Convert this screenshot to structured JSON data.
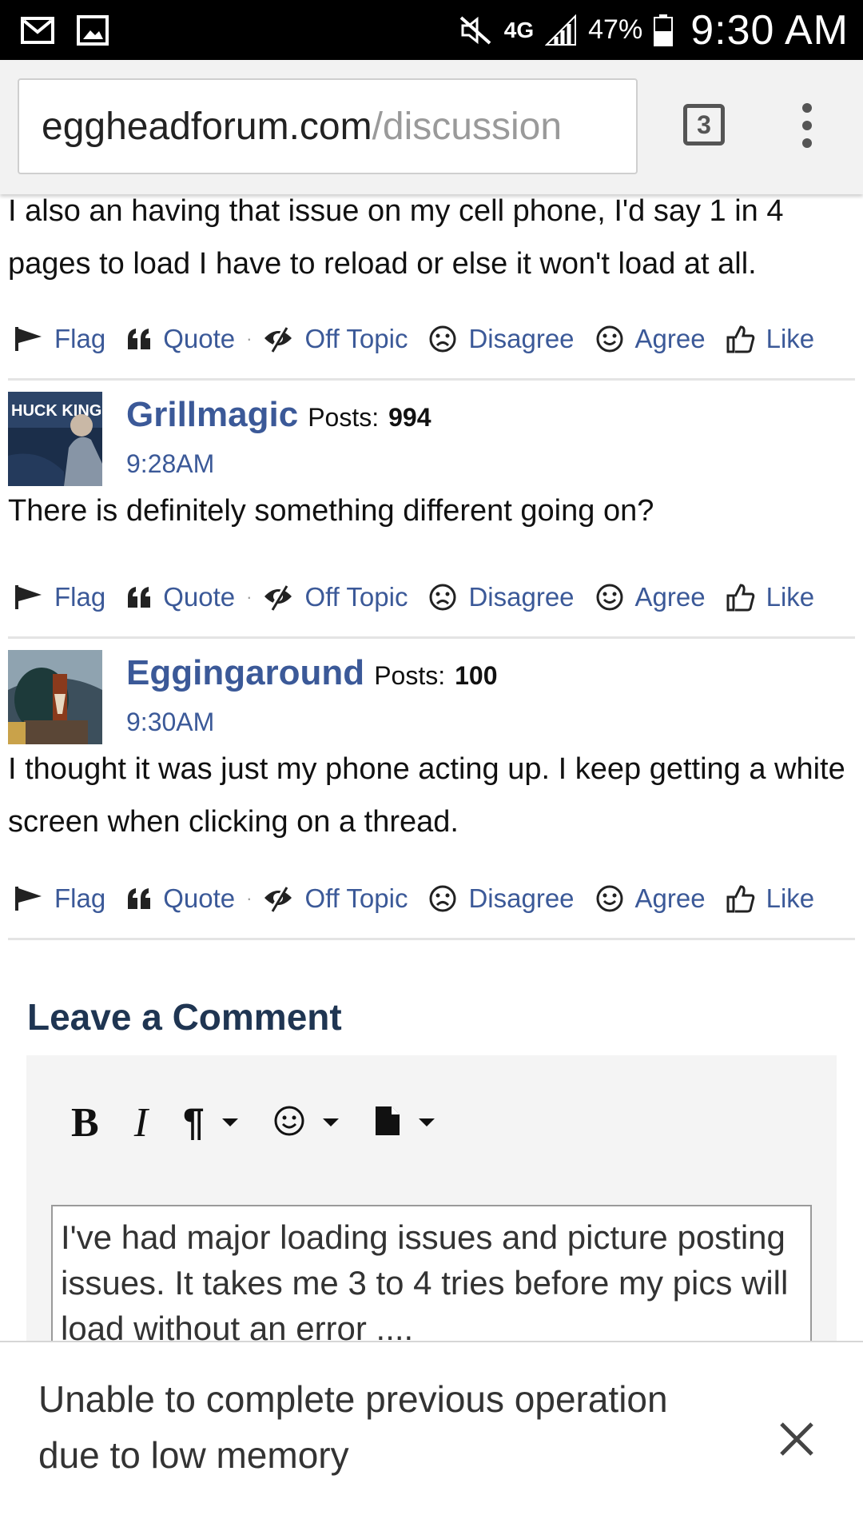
{
  "status_bar": {
    "battery": "47%",
    "time": "9:30 AM",
    "network": "4G"
  },
  "browser": {
    "url_host": "eggheadforum.com",
    "url_path": "/discussion",
    "tab_count": "3"
  },
  "posts": [
    {
      "text": "I also an having that issue on my cell phone, I'd say 1 in 4 pages to load I have to reload or else it won't load at all."
    },
    {
      "author": "Grillmagic",
      "posts_label": "Posts:",
      "posts_count": "994",
      "time": "9:28AM",
      "text": "There is definitely something different going on?"
    },
    {
      "author": "Eggingaround",
      "posts_label": "Posts:",
      "posts_count": "100",
      "time": "9:30AM",
      "text": "I thought it was just my phone acting up. I keep getting a white screen when clicking on a thread."
    }
  ],
  "actions": {
    "flag": "Flag",
    "quote": "Quote",
    "off_topic": "Off Topic",
    "disagree": "Disagree",
    "agree": "Agree",
    "like": "Like"
  },
  "comment": {
    "title": "Leave a Comment",
    "body": "I've had major loading issues and picture posting issues.  It takes me 3 to 4 tries before my pics will load without an error ...."
  },
  "snackbar": {
    "message": "Unable to complete previous operation due to low memory"
  },
  "colors": {
    "link": "#3b5998",
    "heading": "#1f3552"
  }
}
